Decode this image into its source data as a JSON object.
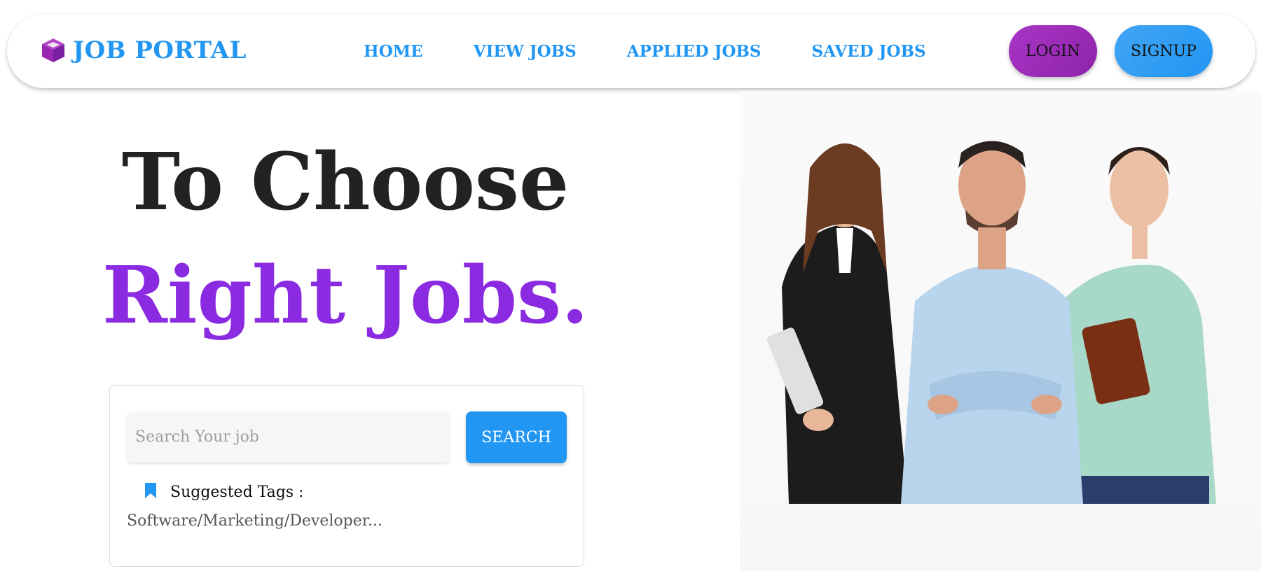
{
  "brand": {
    "name": "JOB PORTAL",
    "icon": "cube-icon",
    "color": "#2196f3",
    "icon_color": "#9c27b0"
  },
  "nav": {
    "items": [
      "HOME",
      "VIEW JOBS",
      "APPLIED JOBS",
      "SAVED JOBS"
    ]
  },
  "auth": {
    "login_label": "LOGIN",
    "signup_label": "SIGNUP"
  },
  "hero": {
    "line1": "To Choose",
    "line2": "Right Jobs.",
    "accent_color": "#8a2be2"
  },
  "search": {
    "placeholder": "Search Your job",
    "value": "",
    "button_label": "SEARCH",
    "tags_icon": "bookmark-icon",
    "tags_label": "Suggested Tags :",
    "tags_list": "Software/Marketing/Developer..."
  },
  "colors": {
    "primary": "#2196f3",
    "purple": "#9c27b0"
  }
}
